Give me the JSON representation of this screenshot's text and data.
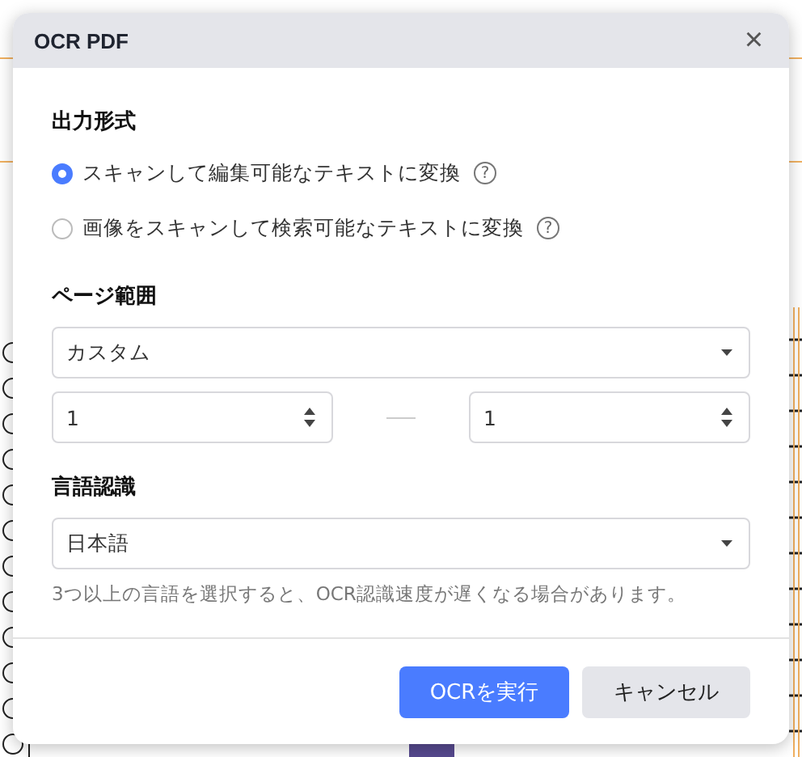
{
  "dialog": {
    "title": "OCR PDF",
    "close": "×"
  },
  "output_format": {
    "label": "出力形式",
    "options": [
      {
        "label": "スキャンして編集可能なテキストに変換",
        "selected": true,
        "help": "?"
      },
      {
        "label": "画像をスキャンして検索可能なテキストに変換",
        "selected": false,
        "help": "?"
      }
    ]
  },
  "page_range": {
    "label": "ページ範囲",
    "mode": "カスタム",
    "from": "1",
    "to": "1"
  },
  "language": {
    "label": "言語認識",
    "value": "日本語",
    "hint": "3つ以上の言語を選択すると、OCR認識速度が遅くなる場合があります。"
  },
  "buttons": [
    {
      "label": "OCRを実行",
      "kind": "primary"
    },
    {
      "label": "キャンセル",
      "kind": "secondary"
    }
  ]
}
